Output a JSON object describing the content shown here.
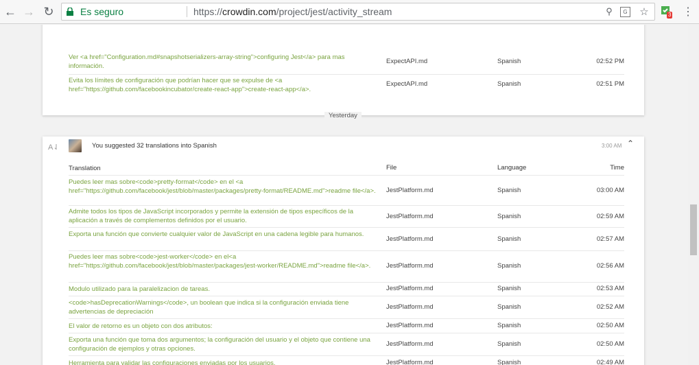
{
  "browser": {
    "secure_label": "Es seguro",
    "url_scheme": "https://",
    "url_host": "crowdin.com",
    "url_path": "/project/jest/activity_stream",
    "extension_badge": "3",
    "icons": [
      "back-icon",
      "forward-icon",
      "reload-icon",
      "lock-icon",
      "zoom-icon",
      "translate-icon",
      "star-icon",
      "extension-icon",
      "menu-icon"
    ]
  },
  "card1": {
    "rows": [
      {
        "translation": "Ver <a href=\"Configuration.md#snapshotserializers-array-string\">configuring Jest</a> para mas información.",
        "file": "ExpectAPI.md",
        "language": "Spanish",
        "time": "02:52 PM"
      },
      {
        "translation": "Evita los límites de configuración que podrían hacer que se expulse de <a href=\"https://github.com/facebookincubator/create-react-app\">create-react-app</a>.",
        "file": "ExpectAPI.md",
        "language": "Spanish",
        "time": "02:51 PM"
      }
    ]
  },
  "day_separator": "Yesterday",
  "card2": {
    "activity_text": "You suggested 32 translations into Spanish",
    "activity_time": "3:00 AM",
    "headers": {
      "translation": "Translation",
      "file": "File",
      "language": "Language",
      "time": "Time"
    },
    "rows": [
      {
        "translation": "Puedes leer mas sobre<code>pretty-format</code> en el <a href=\"https://github.com/facebook/jest/blob/master/packages/pretty-format/README.md\">readme file</a>.",
        "file": "JestPlatform.md",
        "language": "Spanish",
        "time": "03:00 AM"
      },
      {
        "translation": "Admite todos los tipos de JavaScript incorporados y permite la extensión de tipos específicos de la aplicación a través de complementos definidos por el usuario.",
        "file": "JestPlatform.md",
        "language": "Spanish",
        "time": "02:59 AM"
      },
      {
        "translation": "Exporta una función que convierte cualquier valor de JavaScript en una cadena legible para humanos.",
        "file": "JestPlatform.md",
        "language": "Spanish",
        "time": "02:57 AM"
      },
      {
        "translation": "Puedes leer mas sobre<code>jest-worker</code> en el<a href=\"https://github.com/facebook/jest/blob/master/packages/jest-worker/README.md\">readme file</a>.",
        "file": "JestPlatform.md",
        "language": "Spanish",
        "time": "02:56 AM"
      },
      {
        "translation": "Modulo utilizado para la paralelizacion de tareas.",
        "file": "JestPlatform.md",
        "language": "Spanish",
        "time": "02:53 AM"
      },
      {
        "translation": "<code>hasDeprecationWarnings</code>, un boolean que indica si la configuración enviada tiene advertencias de depreciación",
        "file": "JestPlatform.md",
        "language": "Spanish",
        "time": "02:52 AM"
      },
      {
        "translation": "El valor de retorno es un objeto con dos atributos:",
        "file": "JestPlatform.md",
        "language": "Spanish",
        "time": "02:50 AM"
      },
      {
        "translation": "Exporta una función que toma dos argumentos; la configuración del usuario y el objeto que contiene una configuración de ejemplos y otras opciones.",
        "file": "JestPlatform.md",
        "language": "Spanish",
        "time": "02:50 AM"
      },
      {
        "translation": "Herramienta para validar las configuraciones enviadas por los usuarios.",
        "file": "JestPlatform.md",
        "language": "Spanish",
        "time": "02:49 AM"
      }
    ]
  },
  "colors": {
    "accent_green": "#79a33f",
    "secure_green": "#0b8043"
  }
}
